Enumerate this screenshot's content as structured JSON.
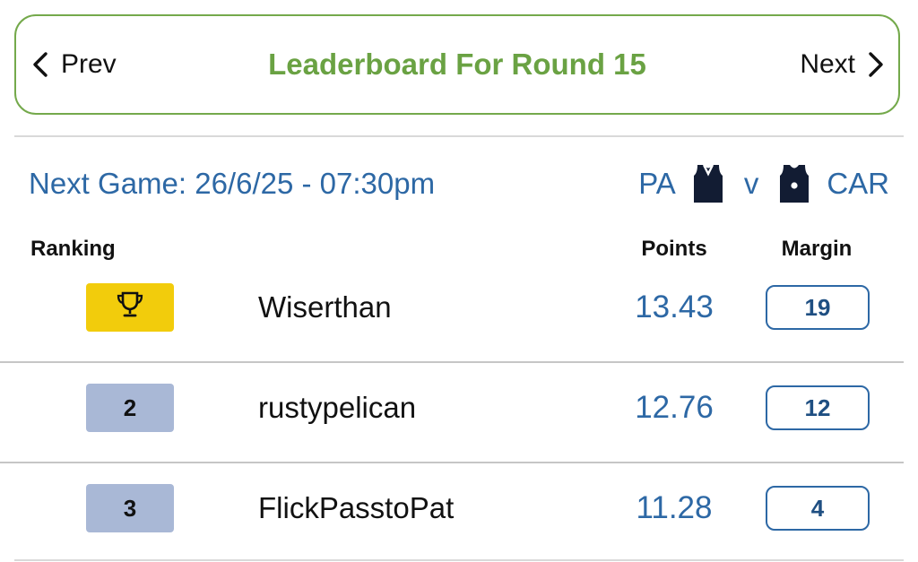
{
  "header": {
    "prev_label": "Prev",
    "title": "Leaderboard For Round 15",
    "next_label": "Next"
  },
  "next_game": {
    "label": "Next Game: 26/6/25 - 07:30pm",
    "home_team": "PA",
    "home_jersey_icon": "dark-navy-jersey-with-v-neck-icon",
    "versus": "v",
    "away_team": "CAR",
    "away_jersey_icon": "dark-navy-jersey-with-white-dot-icon"
  },
  "columns": {
    "ranking": "Ranking",
    "points": "Points",
    "margin": "Margin"
  },
  "rows": [
    {
      "rank": "",
      "rank_icon": "trophy-icon",
      "name": "Wiserthan",
      "points": "13.43",
      "margin": "19"
    },
    {
      "rank": "2",
      "name": "rustypelican",
      "points": "12.76",
      "margin": "12"
    },
    {
      "rank": "3",
      "name": "FlickPasstoPat",
      "points": "11.28",
      "margin": "4"
    }
  ],
  "colors": {
    "accent_green": "#6aa243",
    "link_blue": "#2d68a5",
    "gold_badge": "#f2cc0c",
    "rank_badge_blue": "#a9b8d6",
    "jersey_navy": "#121c33"
  }
}
